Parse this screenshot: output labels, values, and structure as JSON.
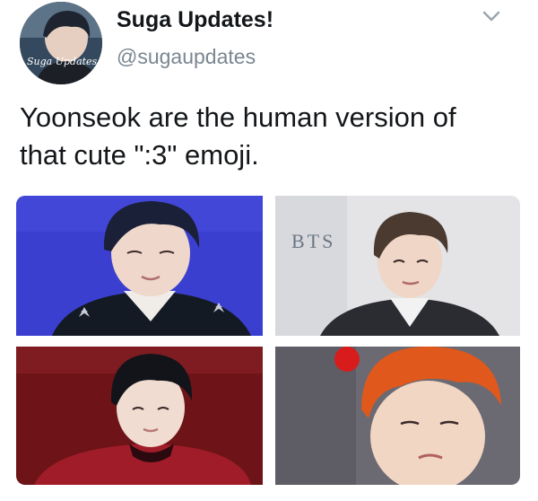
{
  "account": {
    "display_name": "Suga Updates!",
    "handle": "@sugaupdates",
    "avatar_watermark": "Suga Updates"
  },
  "tweet": {
    "text_line1": "Yoonseok are the human version of",
    "text_line2": "that cute \":3\" emoji."
  },
  "media": {
    "photos": [
      {
        "subject": "person-blue-background",
        "background_color": "#3a3fd0"
      },
      {
        "subject": "person-light-background",
        "background_color": "#e4e4e6",
        "visible_text": "BTS"
      },
      {
        "subject": "person-red-background",
        "background_color": "#6e1418"
      },
      {
        "subject": "person-orange-hair",
        "background_color": "#6b6a72"
      }
    ]
  },
  "icons": {
    "caret": "chevron-down-icon"
  }
}
